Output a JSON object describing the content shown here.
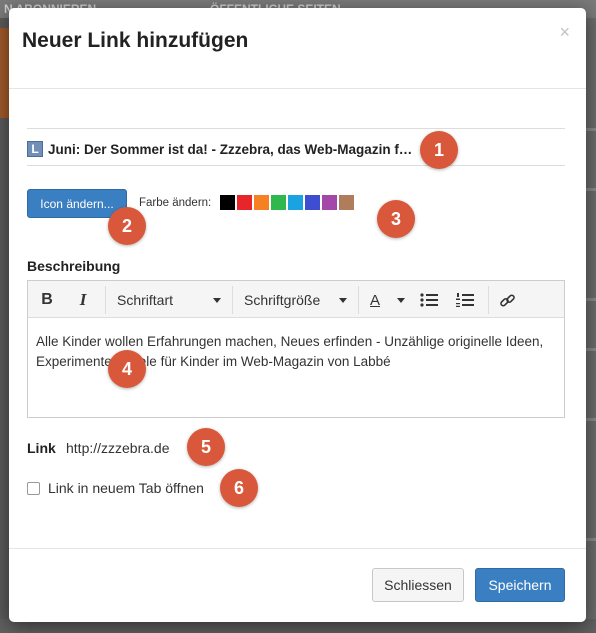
{
  "background": {
    "left_text": "N ABONNIEREN",
    "center_text": "ÖFFENTLICHE SEITEN"
  },
  "modal": {
    "title": "Neuer Link hinzufügen",
    "close_glyph": "×"
  },
  "link_title": {
    "icon_letter": "L",
    "text": "Juni: Der Sommer ist da! - Zzzebra, das Web-Magazin f…"
  },
  "icon_button": {
    "label": "Icon ändern..."
  },
  "color_picker": {
    "label": "Farbe ändern:",
    "colors": [
      "#000000",
      "#e8262a",
      "#f68122",
      "#2fb84b",
      "#1aa3e0",
      "#3d4ed1",
      "#a347a8",
      "#b07d5c"
    ]
  },
  "description": {
    "label": "Beschreibung",
    "toolbar": {
      "bold": "B",
      "italic": "I",
      "font_select": "Schriftart",
      "size_select": "Schriftgröße",
      "color_letter": "A"
    },
    "text": "Alle Kinder wollen Erfahrungen machen, Neues erfinden - Unzählige originelle Ideen, Experimente, Spiele für Kinder im Web-Magazin von Labbé"
  },
  "link": {
    "label": "Link",
    "value": "http://zzzebra.de"
  },
  "new_tab": {
    "label": "Link in neuem Tab öffnen",
    "checked": false
  },
  "footer": {
    "close_label": "Schliessen",
    "save_label": "Speichern"
  },
  "markers": [
    "1",
    "2",
    "3",
    "4",
    "5",
    "6"
  ]
}
